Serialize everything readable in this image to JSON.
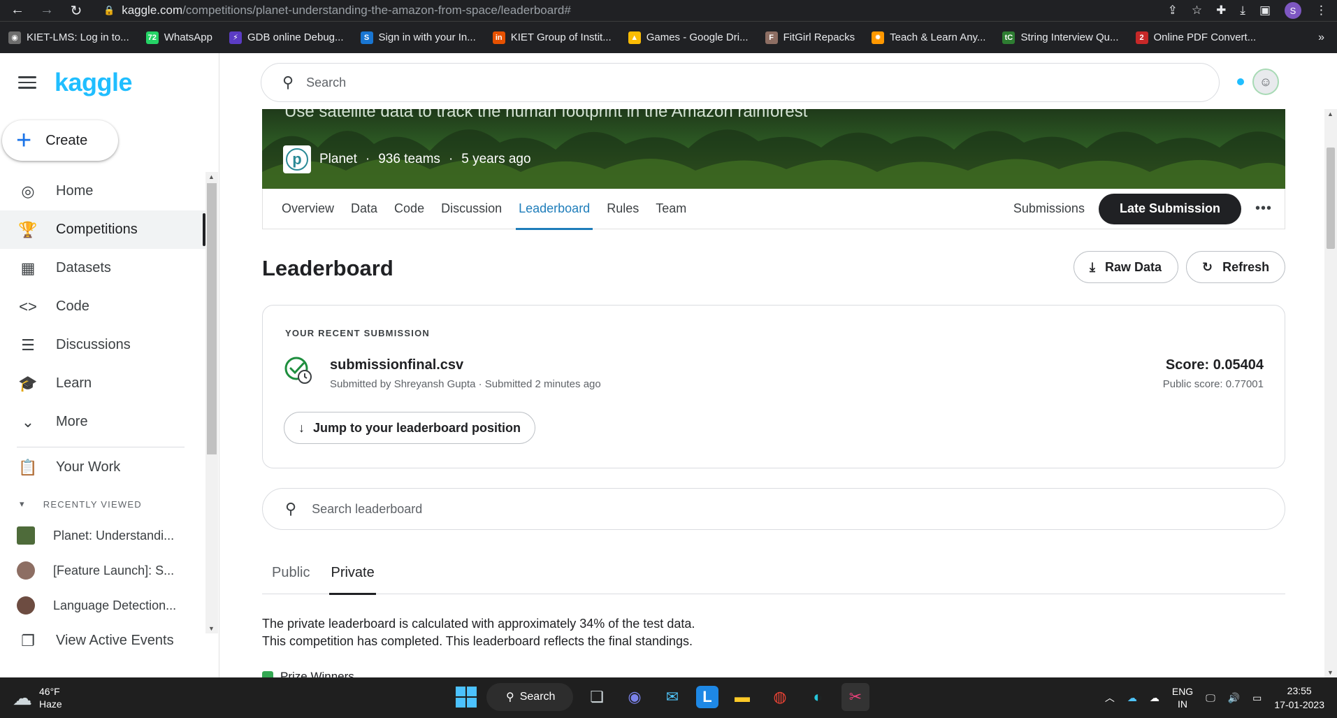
{
  "browser": {
    "url_host": "kaggle.com",
    "url_path": "/competitions/planet-understanding-the-amazon-from-space/leaderboard#",
    "profile_initial": "S",
    "bookmarks": [
      {
        "label": "KIET-LMS: Log in to...",
        "color": "#6d6d6d",
        "glyph": "◉"
      },
      {
        "label": "WhatsApp",
        "color": "#25d366",
        "glyph": "72"
      },
      {
        "label": "GDB online Debug...",
        "color": "#5b3cc4",
        "glyph": "⚡"
      },
      {
        "label": "Sign in with your In...",
        "color": "#1976d2",
        "glyph": "S"
      },
      {
        "label": "KIET Group of Instit...",
        "color": "#e65100",
        "glyph": "in"
      },
      {
        "label": "Games - Google Dri...",
        "color": "#fbbc04",
        "glyph": "▲"
      },
      {
        "label": "FitGirl Repacks",
        "color": "#8d6e63",
        "glyph": "F"
      },
      {
        "label": "Teach & Learn Any...",
        "color": "#ff9800",
        "glyph": "✹"
      },
      {
        "label": "String Interview Qu...",
        "color": "#2e7d32",
        "glyph": "tC"
      },
      {
        "label": "Online PDF Convert...",
        "color": "#c62828",
        "glyph": "2"
      }
    ],
    "more_glyph": "»"
  },
  "sidebar": {
    "logo": "kaggle",
    "create_label": "Create",
    "nav": [
      {
        "label": "Home",
        "icon": "◎",
        "name": "home"
      },
      {
        "label": "Competitions",
        "icon": "🏆",
        "name": "competitions"
      },
      {
        "label": "Datasets",
        "icon": "▦",
        "name": "datasets"
      },
      {
        "label": "Code",
        "icon": "<>",
        "name": "code"
      },
      {
        "label": "Discussions",
        "icon": "☰",
        "name": "discussions"
      },
      {
        "label": "Learn",
        "icon": "🎓",
        "name": "learn"
      },
      {
        "label": "More",
        "icon": "⌄",
        "name": "more"
      }
    ],
    "your_work": "Your Work",
    "recently_viewed": "RECENTLY VIEWED",
    "recent": [
      {
        "label": "Planet: Understandi...",
        "color": "#4e6b3a"
      },
      {
        "label": "[Feature Launch]: S...",
        "color": "#8d6e63"
      },
      {
        "label": "Language Detection...",
        "color": "#6d4c41"
      }
    ],
    "active_events": "View Active Events"
  },
  "main": {
    "search_placeholder": "Search",
    "banner": {
      "subtitle": "Use satellite data to track the human footprint in the Amazon rainforest",
      "host": "Planet",
      "teams": "936 teams",
      "age": "5 years ago",
      "sep": "·"
    },
    "tabs": [
      "Overview",
      "Data",
      "Code",
      "Discussion",
      "Leaderboard",
      "Rules",
      "Team"
    ],
    "active_tab": "Leaderboard",
    "submissions_label": "Submissions",
    "late_submission_label": "Late Submission",
    "title": "Leaderboard",
    "raw_data_label": "Raw Data",
    "refresh_label": "Refresh",
    "recent_submission": {
      "label": "YOUR RECENT SUBMISSION",
      "file": "submissionfinal.csv",
      "submitted": "Submitted by Shreyansh Gupta · Submitted 2 minutes ago",
      "score": "Score: 0.05404",
      "public_score": "Public score: 0.77001",
      "jump_label": "Jump to your leaderboard position"
    },
    "lb_search_placeholder": "Search leaderboard",
    "board_tabs": [
      "Public",
      "Private"
    ],
    "active_board_tab": "Private",
    "info_line1": "The private leaderboard is calculated with approximately 34% of the test data.",
    "info_line2": "This competition has completed. This leaderboard reflects the final standings.",
    "prize_label": "Prize Winners"
  },
  "taskbar": {
    "temp": "46°F",
    "condition": "Haze",
    "search_label": "Search",
    "lang1": "ENG",
    "lang2": "IN",
    "time": "23:55",
    "date": "17-01-2023"
  }
}
